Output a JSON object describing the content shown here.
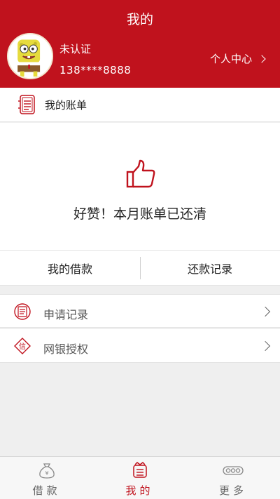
{
  "header": {
    "title": "我的",
    "user_status": "未认证",
    "phone": "138****8888",
    "profile_link": "个人中心"
  },
  "bill": {
    "section_label": "我的账单",
    "message": "好赞！本月账单已还清"
  },
  "actions": {
    "my_loans": "我的借款",
    "repayment_records": "还款记录"
  },
  "menu": [
    {
      "label": "申请记录",
      "icon": "application-record-icon"
    },
    {
      "label": "网银授权",
      "icon": "bank-authorization-icon"
    }
  ],
  "tabbar": [
    {
      "label": "借款",
      "icon": "money-bag-icon",
      "active": false
    },
    {
      "label": "我的",
      "icon": "profile-icon",
      "active": true
    },
    {
      "label": "更多",
      "icon": "more-icon",
      "active": false
    }
  ],
  "colors": {
    "brand_red": "#c0121d",
    "background": "#efefef"
  }
}
